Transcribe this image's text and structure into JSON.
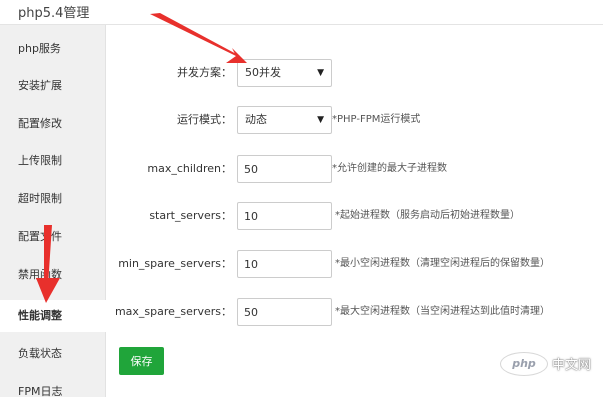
{
  "header": {
    "title": "php5.4管理"
  },
  "sidebar": {
    "items": [
      {
        "label": "php服务"
      },
      {
        "label": "安装扩展"
      },
      {
        "label": "配置修改"
      },
      {
        "label": "上传限制"
      },
      {
        "label": "超时限制"
      },
      {
        "label": "配置文件"
      },
      {
        "label": "禁用函数"
      },
      {
        "label": "性能调整",
        "active": true
      },
      {
        "label": "负载状态"
      },
      {
        "label": "FPM日志"
      }
    ]
  },
  "form": {
    "concurrency": {
      "label": "并发方案：",
      "value": "50并发"
    },
    "run_mode": {
      "label": "运行模式：",
      "value": "动态",
      "hint": "*PHP-FPM运行模式"
    },
    "max_children": {
      "label": "max_children：",
      "value": "50",
      "hint": "*允许创建的最大子进程数"
    },
    "start_servers": {
      "label": "start_servers：",
      "value": "10",
      "hint": "*起始进程数（服务启动后初始进程数量）"
    },
    "min_spare_servers": {
      "label": "min_spare_servers：",
      "value": "10",
      "hint": "*最小空闲进程数（清理空闲进程后的保留数量）"
    },
    "max_spare_servers": {
      "label": "max_spare_servers：",
      "value": "50",
      "hint": "*最大空闲进程数（当空闲进程达到此值时清理）"
    },
    "save_label": "保存"
  },
  "watermark": {
    "logo": "php",
    "text": "中文网"
  },
  "colors": {
    "accent": "#20a53a",
    "arrow": "#e8302c",
    "sidebar_bg": "#f0f0f0"
  }
}
